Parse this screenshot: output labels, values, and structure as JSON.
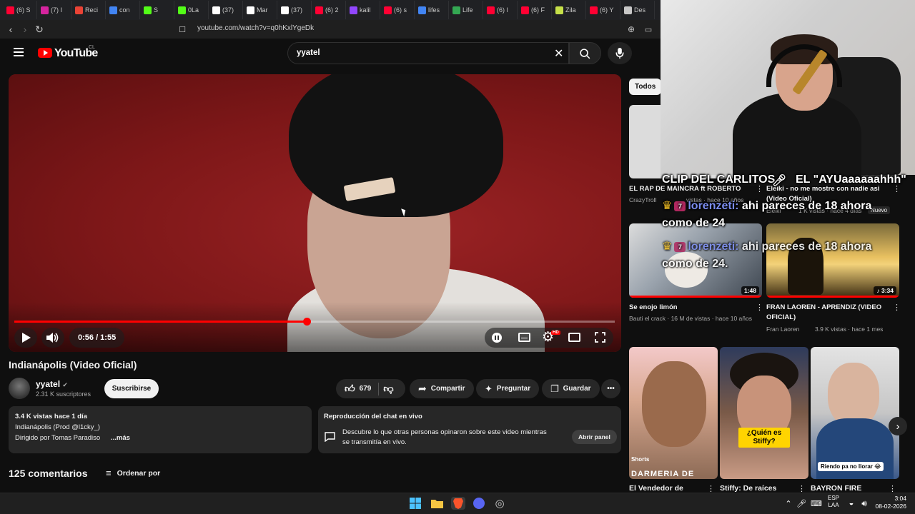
{
  "browser": {
    "tabs": [
      {
        "label": "(6) S",
        "color": "#ff0033"
      },
      {
        "label": "(7) I",
        "color": "#d6249f"
      },
      {
        "label": "Reci",
        "color": "#ea4335"
      },
      {
        "label": "con",
        "color": "#4285f4"
      },
      {
        "label": "S",
        "color": "#53fc18"
      },
      {
        "label": "0La",
        "color": "#53fc18"
      },
      {
        "label": "(37)",
        "color": "#ffffff"
      },
      {
        "label": "Mar",
        "color": "#ffffff"
      },
      {
        "label": "(37)",
        "color": "#ffffff"
      },
      {
        "label": "(6) 2",
        "color": "#ff0033"
      },
      {
        "label": "kalil",
        "color": "#9146ff"
      },
      {
        "label": "(6) s",
        "color": "#ff0033"
      },
      {
        "label": "lifes",
        "color": "#4285f4"
      },
      {
        "label": "Life",
        "color": "#34a853"
      },
      {
        "label": "(6) l",
        "color": "#ff0033"
      },
      {
        "label": "(6) F",
        "color": "#ff0033"
      },
      {
        "label": "Zila",
        "color": "#c6e049"
      },
      {
        "label": "(6) Y",
        "color": "#ff0033"
      },
      {
        "label": "Des",
        "color": "#c8c8c8"
      }
    ],
    "url": "youtube.com/watch?v=q0hKxlYgeDk"
  },
  "header": {
    "logo_text": "YouTube",
    "region": "CL",
    "search_value": "yyatel"
  },
  "player": {
    "current_time": "0:56",
    "duration": "1:55",
    "time_display": "0:56 / 1:55",
    "progress_fraction": 0.487,
    "hd_badge": "HD"
  },
  "video": {
    "title": "Indianápolis (Video Oficial)",
    "channel": "yyatel",
    "subscribers": "2.31 K suscriptores",
    "subscribe_label": "Suscribirse",
    "likes": "679",
    "share_label": "Compartir",
    "ask_label": "Preguntar",
    "save_label": "Guardar"
  },
  "description": {
    "meta": "3.4 K vistas  hace 1 día",
    "line1": "Indianápolis (Prod @l1cky_)",
    "line2": "Dirigido por Tomas Paradiso",
    "more": "...más"
  },
  "chat_card": {
    "title": "Reproducción del chat en vivo",
    "line1": "Descubre lo que otras personas opinaron sobre este video mientras",
    "line2": "se transmitía en vivo.",
    "button": "Abrir panel"
  },
  "comments": {
    "count_label": "125 comentarios",
    "sort_label": "Ordenar por"
  },
  "sidebar": {
    "chip": "Todos",
    "videos": [
      {
        "title": "EL RAP DE MAINCRA ft ROBERTO",
        "meta": "CrazyTroll",
        "meta2": "vistas · hace 10 años"
      },
      {
        "title": "Eleiki - no me mostre con nadie asi",
        "title2": "(Video Oficial)",
        "meta": "Eleiki",
        "meta2": "1 K vistas · hace 4 días",
        "badge": "Nuevo"
      },
      {
        "title": "Se enojo limón",
        "meta": "Bauti el crack · 16 M de vistas · hace 10 años",
        "duration": "1:48"
      },
      {
        "title": "FRAN LAOREN - APRENDIZ (VIDEO",
        "title2": "OFICIAL)",
        "meta": "Fran Laoren",
        "meta2": "3.9 K vistas · hace 1 mes",
        "duration": "3:34"
      }
    ],
    "shorts": [
      {
        "caption": "DARMERIA DE CHILE",
        "title": "El Vendedor de",
        "tag": "Shorts"
      },
      {
        "caption": "¿Quién es Stiffy?",
        "title": "Stiffy: De raíces"
      },
      {
        "caption": "Riendo pa no llorar 😂",
        "title": "BAYRON FIRE"
      }
    ]
  },
  "stream_overlay": {
    "clip_title": "CLIP DEL CARLITOS",
    "clip_quote": "EL \"AYUaaaaaahhh\"",
    "chat_user": "lorenzeti:",
    "chat_msg_a": "ahi pareces de 18 ahora",
    "chat_msg_b": "como de 24",
    "chat_msg_c": "ahi pareces de 18 ahora",
    "chat_msg_d": "como de 24."
  },
  "taskbar": {
    "lang1": "ESP",
    "lang2": "LAA",
    "time": "3:04",
    "date": "08-02-2026"
  }
}
